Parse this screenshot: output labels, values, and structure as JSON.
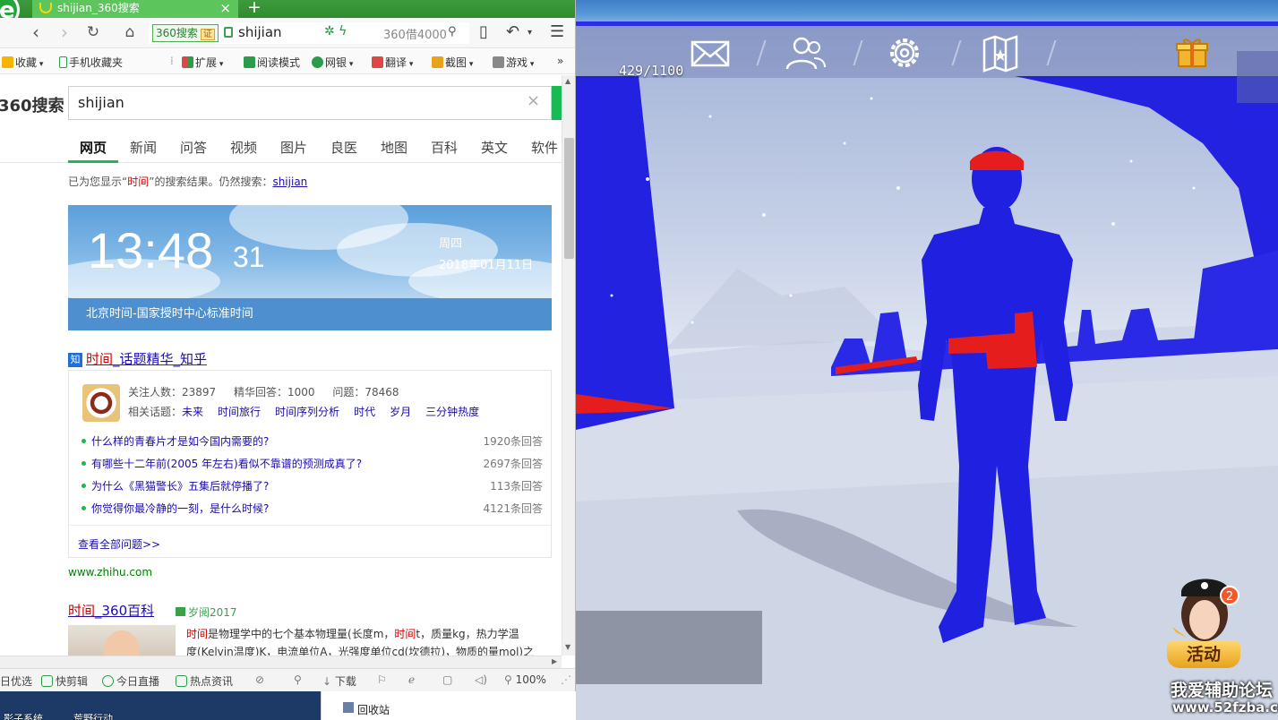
{
  "browser": {
    "tab_title": "shijian_360搜索",
    "tab_close": "×",
    "new_tab": "+",
    "address_badge": "360搜索",
    "address_badge_tag": "证",
    "address_text": "shijian",
    "address_search_placeholder": "360借4000",
    "bookmarks": [
      "收藏",
      "手机收藏夹",
      "扩展",
      "阅读模式",
      "网银",
      "翻译",
      "截图",
      "游戏"
    ],
    "bookmarks_more": "»"
  },
  "search": {
    "logo": "360搜索",
    "query": "shijian",
    "tabs": [
      "网页",
      "新闻",
      "问答",
      "视频",
      "图片",
      "良医",
      "地图",
      "百科",
      "英文",
      "软件"
    ],
    "hint_prefix": "已为您显示“",
    "hint_keyword": "时间",
    "hint_middle": "”的搜索结果。仍然搜索：",
    "hint_link": "shijian"
  },
  "clock": {
    "time": "13:48",
    "seconds": "31",
    "weekday": "周四",
    "date": "2018年01月11日",
    "footer": "北京时间-国家授时中心标准时间"
  },
  "zhihu": {
    "icon": "知",
    "title_kw": "时间",
    "title_rest": "_话题精华_知乎",
    "followers": "关注人数：23897",
    "featured": "精华回答：1000",
    "questions": "问题：78468",
    "topics_label": "相关话题：",
    "topics": [
      "未来",
      "时间旅行",
      "时间序列分析",
      "时代",
      "岁月",
      "三分钟热度"
    ],
    "items": [
      {
        "q": "什么样的青春片才是如今国内需要的?",
        "count": "1920条回答"
      },
      {
        "q": "有哪些十二年前(2005 年左右)看似不靠谱的预测成真了?",
        "count": "2697条回答"
      },
      {
        "q": "为什么《黑猫警长》五集后就停播了?",
        "count": "113条回答"
      },
      {
        "q": "你觉得你最冷静的一刻，是什么时候?",
        "count": "4121条回答"
      }
    ],
    "more": "查看全部问题>>",
    "url": "www.zhihu.com"
  },
  "baike": {
    "title_kw": "时间",
    "title_rest": "_360百科",
    "tag": "岁阅2017",
    "line1_a": "时间",
    "line1_b": "是物理学中的七个基本物理量(长度m，",
    "line1_c": "时间",
    "line1_d": "t，质量kg，热力学温",
    "line2": "度(Kelvin温度)K，电流单位A，光强度单位cd(坎德拉)，物质的量mol)之"
  },
  "statusbar": {
    "items": [
      "日优选",
      "快剪辑",
      "今日直播",
      "热点资讯",
      "下载",
      "100%"
    ]
  },
  "desktop": {
    "item1": "影子系统",
    "item2": "荒野行动",
    "item3": "回收站"
  },
  "game": {
    "hp": "429/1100",
    "activity_label": "活动",
    "activity_badge": "2",
    "watermark": "我爱辅助论坛",
    "watermark_url": "www.52fzba.com"
  }
}
